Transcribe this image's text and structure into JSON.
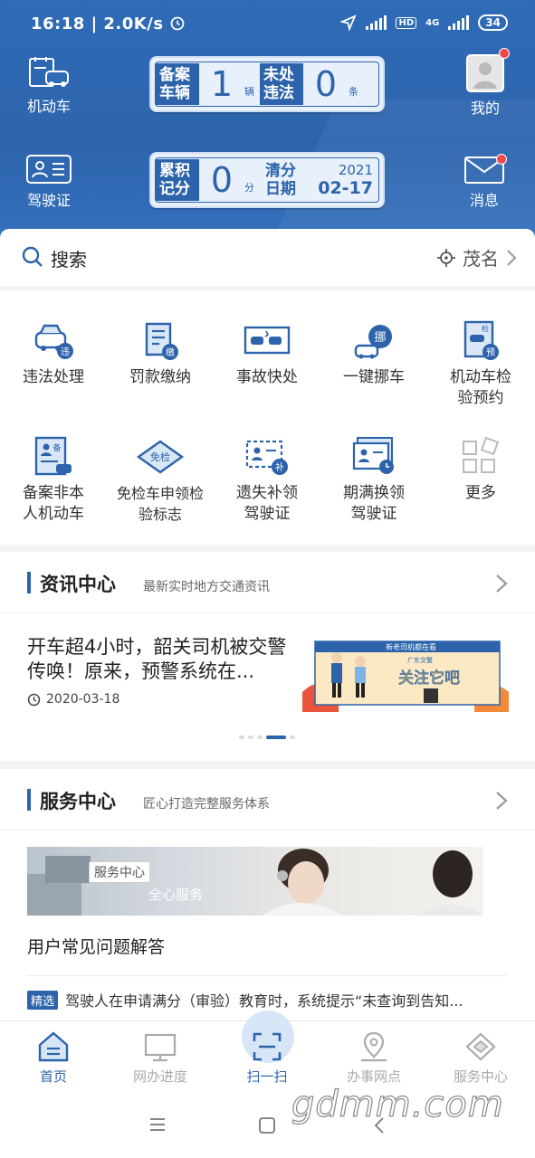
{
  "status_bar": {
    "time": "16:18",
    "speed": "2.0K/s",
    "net": "4G",
    "hd": "HD",
    "battery": "34"
  },
  "header": {
    "vehicle_label": "机动车",
    "license_label": "驾驶证",
    "mine_label": "我的",
    "message_label": "消息",
    "card_vehicle": {
      "label_line1": "备案",
      "label_line2": "车辆",
      "value": "1",
      "unit": "辆",
      "label2_line1": "未处",
      "label2_line2": "违法",
      "value2": "0",
      "unit2": "条"
    },
    "card_points": {
      "label_line1": "累积",
      "label_line2": "记分",
      "value": "0",
      "unit": "分",
      "label2_line1": "清分",
      "label2_line2": "日期",
      "year": "2021",
      "date": "02-17"
    }
  },
  "search": {
    "label": "搜索",
    "location": "茂名"
  },
  "services": [
    {
      "label": "违法处理",
      "icon": "violation-icon"
    },
    {
      "label": "罚款缴纳",
      "icon": "fine-icon"
    },
    {
      "label": "事故快处",
      "icon": "accident-icon"
    },
    {
      "label": "一键挪车",
      "icon": "move-car-icon"
    },
    {
      "label": "机动车检验预约",
      "icon": "inspection-icon"
    },
    {
      "label": "备案非本人机动车",
      "icon": "register-icon"
    },
    {
      "label": "免检车申领检验标志",
      "icon": "exempt-icon"
    },
    {
      "label": "遗失补领驾驶证",
      "icon": "reissue-icon"
    },
    {
      "label": "期满换领驾驶证",
      "icon": "renew-icon"
    },
    {
      "label": "更多",
      "icon": "more-icon"
    }
  ],
  "news": {
    "title": "资讯中心",
    "subtitle": "最新实时地方交通资讯",
    "article_title": "开车超4小时，韶关司机被交警传唤！原来，预警系统在...",
    "article_date": "2020-03-18",
    "image_text": {
      "top": "新老司机都在看",
      "mid": "广东交警",
      "main": "关注它吧"
    }
  },
  "service_center": {
    "title": "服务中心",
    "subtitle": "匠心打造完整服务体系",
    "banner_badge": "服务中心",
    "banner_text": "全心服务",
    "faq_title": "用户常见问题解答",
    "faq_tag": "精选",
    "faq_item": "驾驶人在申请满分（审验）教育时，系统提示“未查询到告知..."
  },
  "bottom_nav": [
    {
      "label": "首页",
      "icon": "home-icon"
    },
    {
      "label": "网办进度",
      "icon": "monitor-icon"
    },
    {
      "label": "扫一扫",
      "icon": "scan-icon"
    },
    {
      "label": "办事网点",
      "icon": "location-icon"
    },
    {
      "label": "服务中心",
      "icon": "service-icon"
    }
  ],
  "watermark": "gdmm.com"
}
